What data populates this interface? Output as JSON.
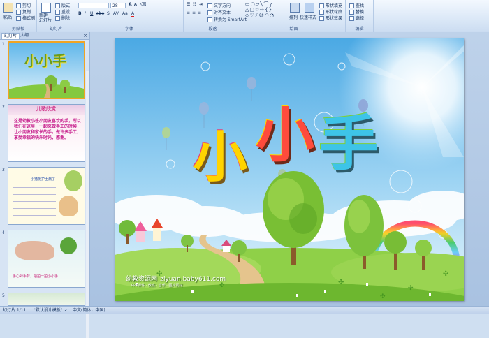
{
  "ribbon": {
    "groups": {
      "clipboard": "剪贴板",
      "slides": "幻灯片",
      "font": "字体",
      "paragraph": "段落",
      "drawing": "绘图",
      "editing": "编辑"
    },
    "buttons": {
      "paste": "粘贴",
      "cut": "剪切",
      "copy": "复制",
      "format_painter": "格式刷",
      "new_slide": "新建\n幻灯片",
      "layout": "版式",
      "reset": "重设",
      "delete": "删除",
      "text_direction": "文字方向",
      "align_text": "对齐文本",
      "smartart": "转换为 SmartArt",
      "arrange": "排列",
      "quick_styles": "快速样式",
      "shape_fill": "形状填充",
      "shape_outline": "形状轮廓",
      "shape_effects": "形状效果",
      "find": "查找",
      "replace": "替换",
      "select": "选择"
    },
    "font_size": "28"
  },
  "panel": {
    "tabs": [
      "幻灯片",
      "大纲"
    ],
    "close": "×",
    "slides": [
      {
        "num": "1",
        "title": "小小手"
      },
      {
        "num": "2",
        "title": "儿歌欣赏",
        "body": "这是幼教小班小朋友喜欢的手，所以我们在这里，一起来做手工的时候，让小朋友和家长的手，做许多手工，享受幸福的快乐时光，感谢。"
      },
      {
        "num": "3",
        "title": "小猪扮护士病了"
      },
      {
        "num": "4",
        "caption": "手心对手背，拍拍一拍小小手"
      },
      {
        "num": "5"
      }
    ]
  },
  "slide": {
    "title_chars": [
      "小",
      "小",
      "手"
    ],
    "watermark_cn": "幼教资源网",
    "watermark_url": "ziyuan.baby611.com",
    "watermark_small": "PPT课件 · 教案 · 音乐 · 图片素材"
  },
  "status": {
    "slide_pos": "幻灯片 1/11",
    "theme": "\"默认设计模板\"",
    "language": "中文(简体，中国)"
  },
  "colors": {
    "ribbon_bg": "#dbe8f7",
    "selected_thumb": "#f0a424",
    "sky": "#7ec7ef",
    "grass": "#7cc23c"
  }
}
